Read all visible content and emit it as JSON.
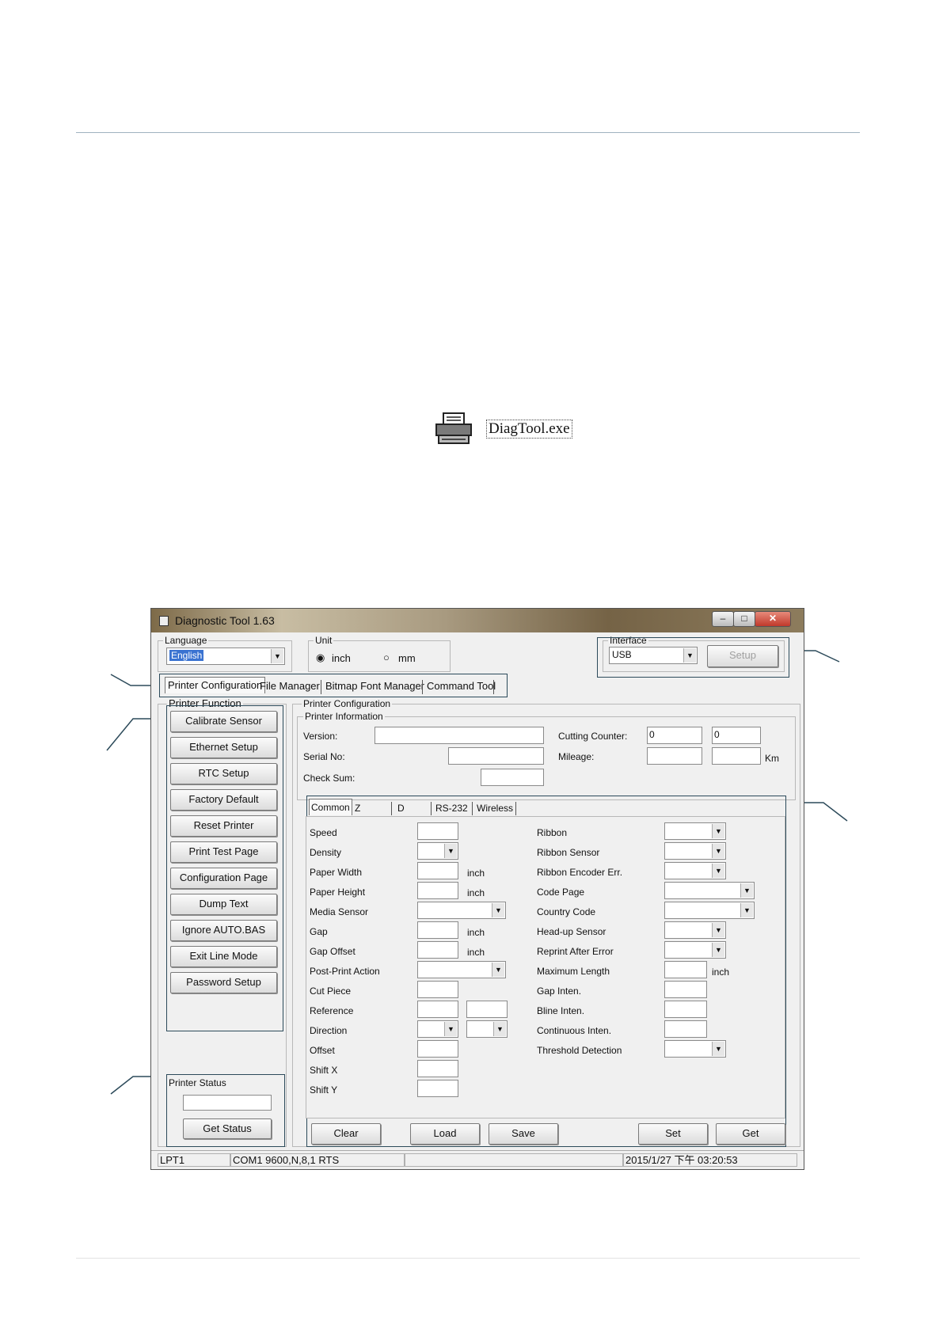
{
  "document": {
    "exe_label": "DiagTool.exe"
  },
  "window": {
    "title": "Diagnostic Tool 1.63",
    "controls": {
      "minimize": "–",
      "maximize": "□",
      "close": "✕"
    }
  },
  "language": {
    "label": "Language",
    "value": "English"
  },
  "unit": {
    "label": "Unit",
    "options": [
      "inch",
      "mm"
    ],
    "selected": "inch"
  },
  "interface": {
    "label": "Interface",
    "value": "USB",
    "setup_button": "Setup"
  },
  "main_tabs": [
    "Printer Configuration",
    "File Manager",
    "Bitmap Font Manager",
    "Command Tool"
  ],
  "printer_function": {
    "label": "Printer Function",
    "buttons": [
      "Calibrate Sensor",
      "Ethernet Setup",
      "RTC Setup",
      "Factory Default",
      "Reset Printer",
      "Print Test Page",
      "Configuration Page",
      "Dump Text",
      "Ignore AUTO.BAS",
      "Exit Line Mode",
      "Password Setup"
    ]
  },
  "printer_status": {
    "label": "Printer Status",
    "value": "",
    "button": "Get Status"
  },
  "printer_configuration": {
    "label": "Printer Configuration",
    "info_label": "Printer Information",
    "version_label": "Version:",
    "serial_label": "Serial No:",
    "checksum_label": "Check Sum:",
    "cutting_counter_label": "Cutting Counter:",
    "cutting_counter_values": [
      "0",
      "0"
    ],
    "mileage_label": "Mileage:",
    "mileage_unit": "Km"
  },
  "sub_tabs": [
    "Common",
    "Z",
    "D",
    "RS-232",
    "Wireless"
  ],
  "common_left": [
    "Speed",
    "Density",
    "Paper Width",
    "Paper Height",
    "Media Sensor",
    "Gap",
    "Gap Offset",
    "Post-Print Action",
    "Cut Piece",
    "Reference",
    "Direction",
    "Offset",
    "Shift X",
    "Shift Y"
  ],
  "common_right": [
    "Ribbon",
    "Ribbon Sensor",
    "Ribbon Encoder Err.",
    "Code Page",
    "Country Code",
    "Head-up Sensor",
    "Reprint After Error",
    "Maximum Length",
    "Gap Inten.",
    "Bline Inten.",
    "Continuous Inten.",
    "Threshold Detection"
  ],
  "unit_inch": "inch",
  "action_buttons": [
    "Clear",
    "Load",
    "Save",
    "Set",
    "Get"
  ],
  "statusbar": {
    "port": "LPT1",
    "com": "COM1 9600,N,8,1 RTS",
    "blank": "",
    "datetime": "2015/1/27 下午 03:20:53"
  }
}
